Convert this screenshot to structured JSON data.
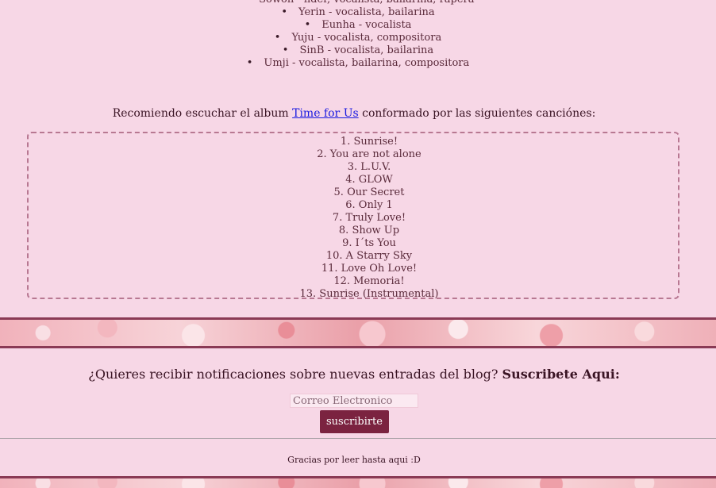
{
  "members": [
    "Sowon - líder, vocalista, bailarina, rapera",
    "Yerin - vocalista, bailarina",
    "Eunha - vocalista",
    "Yuju - vocalista, compositora",
    "SinB - vocalista, bailarina",
    "Umji - vocalista, bailarina, compositora"
  ],
  "recommend": {
    "prefix": "Recomiendo escuchar el album",
    "album_link": "Time for Us",
    "suffix": "conformado por las siguientes canciónes:"
  },
  "tracks": [
    "1. Sunrise!",
    "2. You are not alone",
    "3. L.U.V.",
    "4. GLOW",
    "5. Our Secret",
    "6. Only 1",
    "7. Truly Love!",
    "8. Show Up",
    "9. I´ts You",
    "10. A Starry Sky",
    "11. Love Oh Love!",
    "12. Memoria!",
    "13. Sunrise (Instrumental)"
  ],
  "subscribe": {
    "question": "¿Quieres recibir notificaciones sobre nuevas entradas del blog?",
    "cta": "Suscribete Aqui:",
    "email_placeholder": "Correo Electronico",
    "email_value": "",
    "button_label": "suscribirte"
  },
  "footer": {
    "thanks": "Gracias por leer hasta aqui :D"
  },
  "colors": {
    "background": "#f7d7e6",
    "button": "#7b2340",
    "link": "#1a1ae0",
    "dashed_border": "#b87892"
  }
}
